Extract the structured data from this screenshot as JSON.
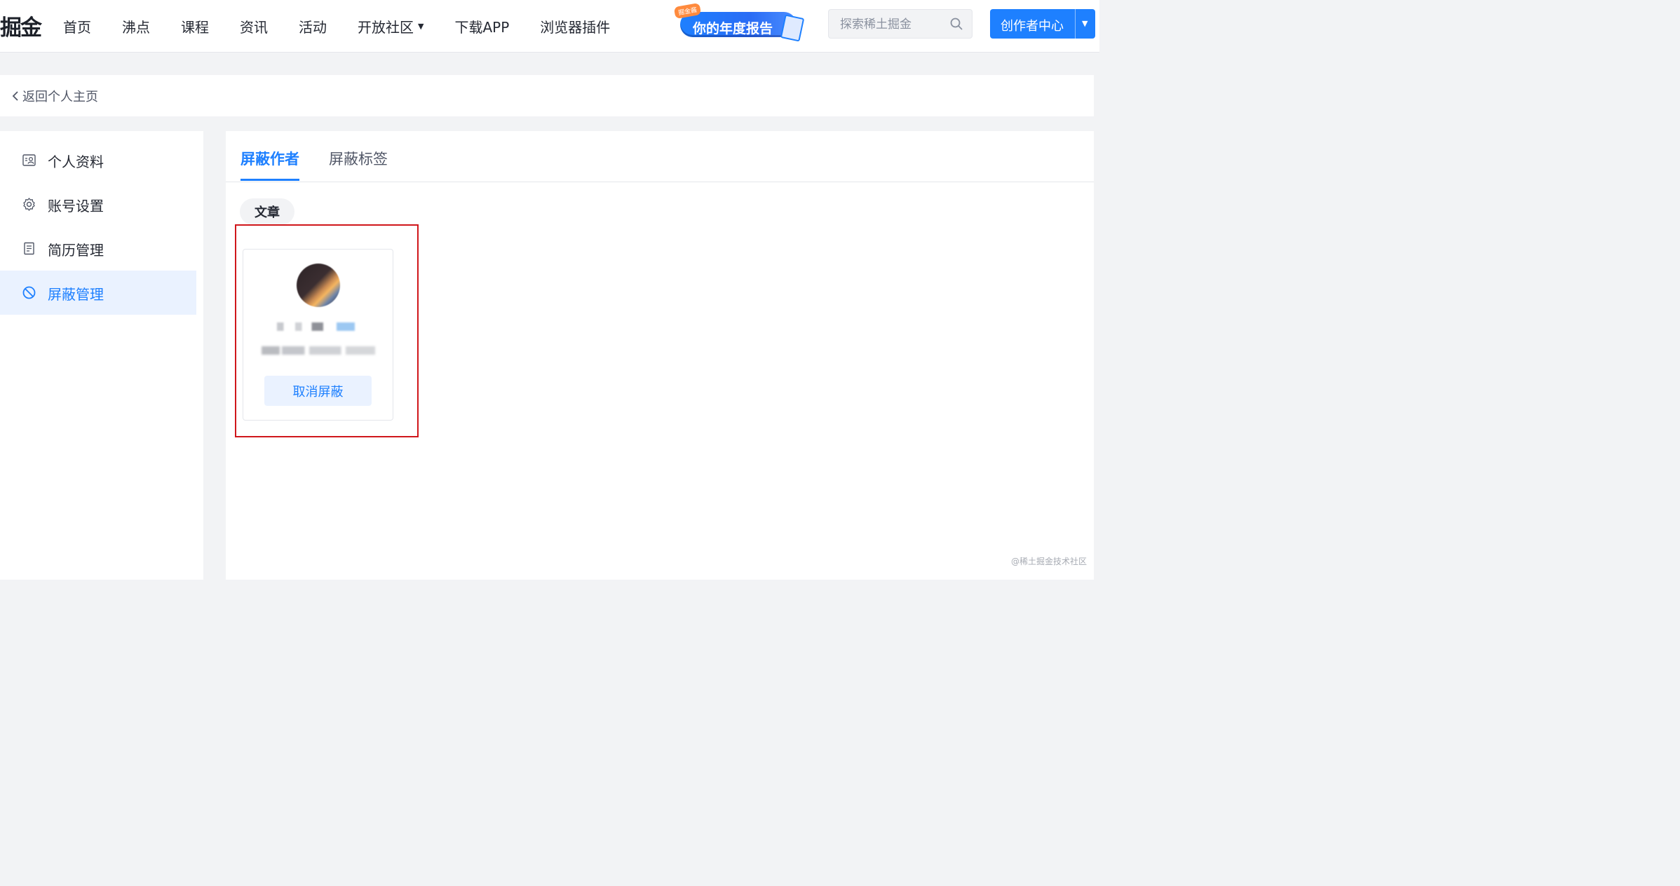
{
  "header": {
    "logo_text": "掘金",
    "nav": [
      {
        "label": "首页"
      },
      {
        "label": "沸点"
      },
      {
        "label": "课程"
      },
      {
        "label": "资讯"
      },
      {
        "label": "活动"
      },
      {
        "label": "开放社区",
        "dropdown": true
      },
      {
        "label": "下载APP"
      },
      {
        "label": "浏览器插件"
      }
    ],
    "report_banner": {
      "text": "你的年度报告",
      "badge": "掘金酱"
    },
    "search": {
      "placeholder": "探索稀土掘金",
      "value": ""
    },
    "creator_button": {
      "label": "创作者中心"
    }
  },
  "backbar": {
    "label": "返回个人主页"
  },
  "sidebar": {
    "items": [
      {
        "label": "个人资料",
        "icon": "profile-card-icon",
        "active": false
      },
      {
        "label": "账号设置",
        "icon": "gear-icon",
        "active": false
      },
      {
        "label": "简历管理",
        "icon": "resume-icon",
        "active": false
      },
      {
        "label": "屏蔽管理",
        "icon": "block-icon",
        "active": true
      }
    ]
  },
  "main": {
    "tabs": [
      {
        "label": "屏蔽作者",
        "active": true
      },
      {
        "label": "屏蔽标签",
        "active": false
      }
    ],
    "filter_chip": "文章",
    "blocked_users": [
      {
        "action_label": "取消屏蔽"
      }
    ]
  },
  "watermark": "@稀土掘金技术社区",
  "colors": {
    "accent": "#1e80ff",
    "highlight_border": "#d0161b",
    "active_bg": "#eaf2ff",
    "page_bg": "#f2f3f5"
  }
}
